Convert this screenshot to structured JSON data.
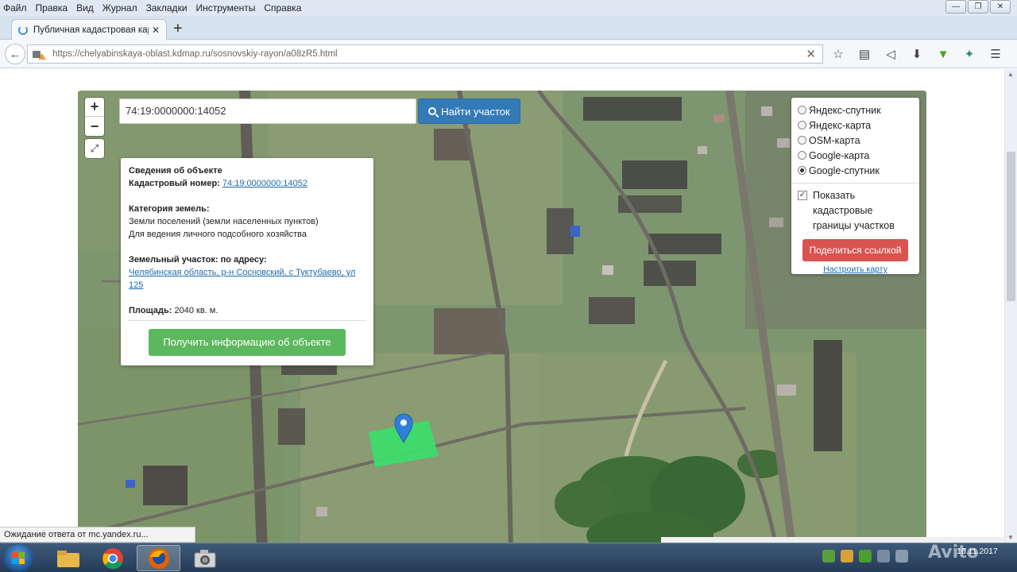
{
  "menu": [
    "Файл",
    "Правка",
    "Вид",
    "Журнал",
    "Закладки",
    "Инструменты",
    "Справка"
  ],
  "tab": {
    "title": "Публичная кадастровая кар"
  },
  "url": "https://chelyabinskaya-oblast.kdmap.ru/sosnovskiy-rayon/a08zR5.html",
  "search": {
    "value": "74:19:0000000:14052",
    "button": "Найти участок"
  },
  "info": {
    "header": "Сведения об объекте",
    "cad_label": "Кадастровый номер:",
    "cad_value": "74:19:0000000:14052",
    "cat_label": "Категория земель:",
    "cat_line1": "Земли поселений (земли населенных пунктов)",
    "cat_line2": "Для ведения личного подсобного хозяйства",
    "addr_label": "Земельный участок: по адресу:",
    "addr_value": "Челябинская область, р-н Сосновский, с Туктубаево, ул 125",
    "area_label": "Площадь:",
    "area_value": "2040 кв. м.",
    "button": "Получить информацию об объекте"
  },
  "layers": {
    "options": [
      "Яндекс-спутник",
      "Яндекс-карта",
      "OSM-карта",
      "Google-карта",
      "Google-спутник"
    ],
    "selected": "Google-спутник",
    "checkbox_label": "Показать кадастровые границы участков",
    "checkbox_checked": true,
    "share_button": "Поделиться ссылкой",
    "configure_link": "Настроить карту"
  },
  "status": "Ожидание ответа от mc.yandex.ru...",
  "clock": {
    "time": "",
    "date": "16.11.2017"
  },
  "watermark": "Avito",
  "colors": {
    "search_button": "#337ab7",
    "get_info_button": "#5cb85c",
    "share_button": "#d9534f",
    "parcel": "#3ddc6c",
    "marker": "#2f7fd8"
  },
  "icons": [
    "back-icon",
    "info-icon",
    "lock-icon",
    "star-icon",
    "reading-list-icon",
    "pocket-icon",
    "download-icon",
    "extension-icon",
    "extension2-icon",
    "menu-icon",
    "zoom-in-icon",
    "zoom-out-icon",
    "fullscreen-icon",
    "search-icon",
    "map-marker-icon"
  ]
}
